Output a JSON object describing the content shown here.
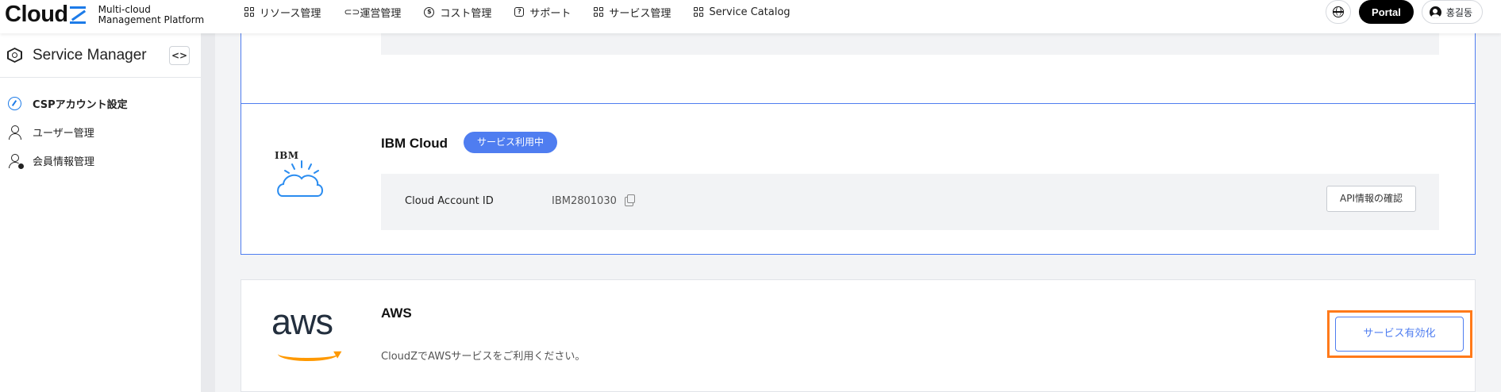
{
  "brand": {
    "logo_text": "CloudZ",
    "subtitle_line1": "Multi-cloud",
    "subtitle_line2": "Management Platform"
  },
  "nav": {
    "items": [
      {
        "label": "リソース管理",
        "icon": "grid-icon"
      },
      {
        "label": "運営管理",
        "icon": "link-icon"
      },
      {
        "label": "コスト管理",
        "icon": "dollar-icon"
      },
      {
        "label": "サポート",
        "icon": "help-icon"
      },
      {
        "label": "サービス管理",
        "icon": "grid-plus-icon"
      },
      {
        "label": "Service Catalog",
        "icon": "grid-plus-icon"
      }
    ],
    "portal_label": "Portal",
    "user_name": "홍길동"
  },
  "sidebar": {
    "title": "Service Manager",
    "collapse_label": "<>",
    "items": [
      {
        "label": "CSPアカウント設定",
        "active": true,
        "icon": "key-icon"
      },
      {
        "label": "ユーザー管理",
        "active": false,
        "icon": "user-icon"
      },
      {
        "label": "会員情報管理",
        "active": false,
        "icon": "user-gear-icon"
      }
    ]
  },
  "providers": {
    "ibm": {
      "logo_text": "IBM",
      "name": "IBM Cloud",
      "status_badge": "サービス利用中",
      "account_label": "Cloud Account ID",
      "account_id": "IBM2801030",
      "api_button": "API情報の確認"
    },
    "aws": {
      "logo_text": "aws",
      "name": "AWS",
      "description": "CloudZでAWSサービスをご利用ください。",
      "enable_button": "サービス有効化"
    }
  },
  "colors": {
    "accent": "#4f7df0",
    "brand_blue": "#1d7be8",
    "highlight": "#ff7a1a",
    "aws_orange": "#ff9900"
  }
}
